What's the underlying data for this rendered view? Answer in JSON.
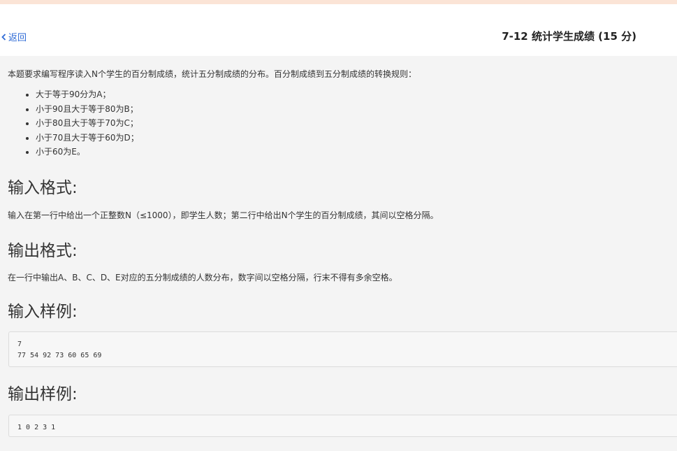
{
  "header": {
    "back_label": "返回",
    "title": "7-12 统计学生成绩 (15 分)"
  },
  "problem": {
    "intro": "本题要求编写程序读入N个学生的百分制成绩，统计五分制成绩的分布。百分制成绩到五分制成绩的转换规则：",
    "rules": [
      "大于等于90分为A；",
      "小于90且大于等于80为B；",
      "小于80且大于等于70为C；",
      "小于70且大于等于60为D；",
      "小于60为E。"
    ],
    "input_heading": "输入格式:",
    "input_text": "输入在第一行中给出一个正整数N（≤1000），即学生人数；第二行中给出N个学生的百分制成绩，其间以空格分隔。",
    "output_heading": "输出格式:",
    "output_text": "在一行中输出A、B、C、D、E对应的五分制成绩的人数分布，数字间以空格分隔，行末不得有多余空格。",
    "sample_input_heading": "输入样例:",
    "sample_input": "7\n77 54 92 73 60 65 69",
    "sample_output_heading": "输出样例:",
    "sample_output": "1 0 2 3 1"
  },
  "colors": {
    "link": "#2f6bd6",
    "top_strip": "#fbe4d6",
    "content_bg": "#f4f4f4"
  },
  "icons": {
    "back": "chevron-left-icon"
  }
}
